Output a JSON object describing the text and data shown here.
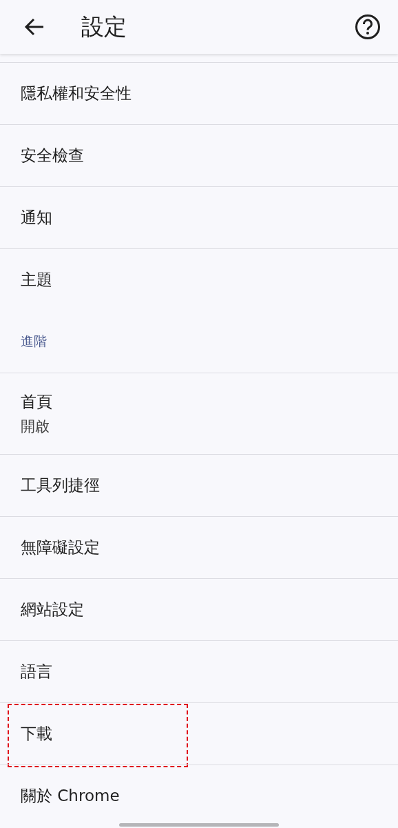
{
  "header": {
    "title": "設定"
  },
  "items": [
    {
      "kind": "item",
      "title": "隱私權和安全性",
      "highlighted": false
    },
    {
      "kind": "item",
      "title": "安全檢查",
      "highlighted": false
    },
    {
      "kind": "item",
      "title": "通知",
      "highlighted": false
    },
    {
      "kind": "item",
      "title": "主題",
      "highlighted": false
    },
    {
      "kind": "section",
      "title": "進階"
    },
    {
      "kind": "item",
      "title": "首頁",
      "subtitle": "開啟",
      "highlighted": false
    },
    {
      "kind": "item",
      "title": "工具列捷徑",
      "highlighted": false
    },
    {
      "kind": "item",
      "title": "無障礙設定",
      "highlighted": false
    },
    {
      "kind": "item",
      "title": "網站設定",
      "highlighted": false
    },
    {
      "kind": "item",
      "title": "語言",
      "highlighted": false
    },
    {
      "kind": "item",
      "title": "下載",
      "highlighted": true
    },
    {
      "kind": "item",
      "title": "關於 Chrome",
      "highlighted": false
    }
  ]
}
